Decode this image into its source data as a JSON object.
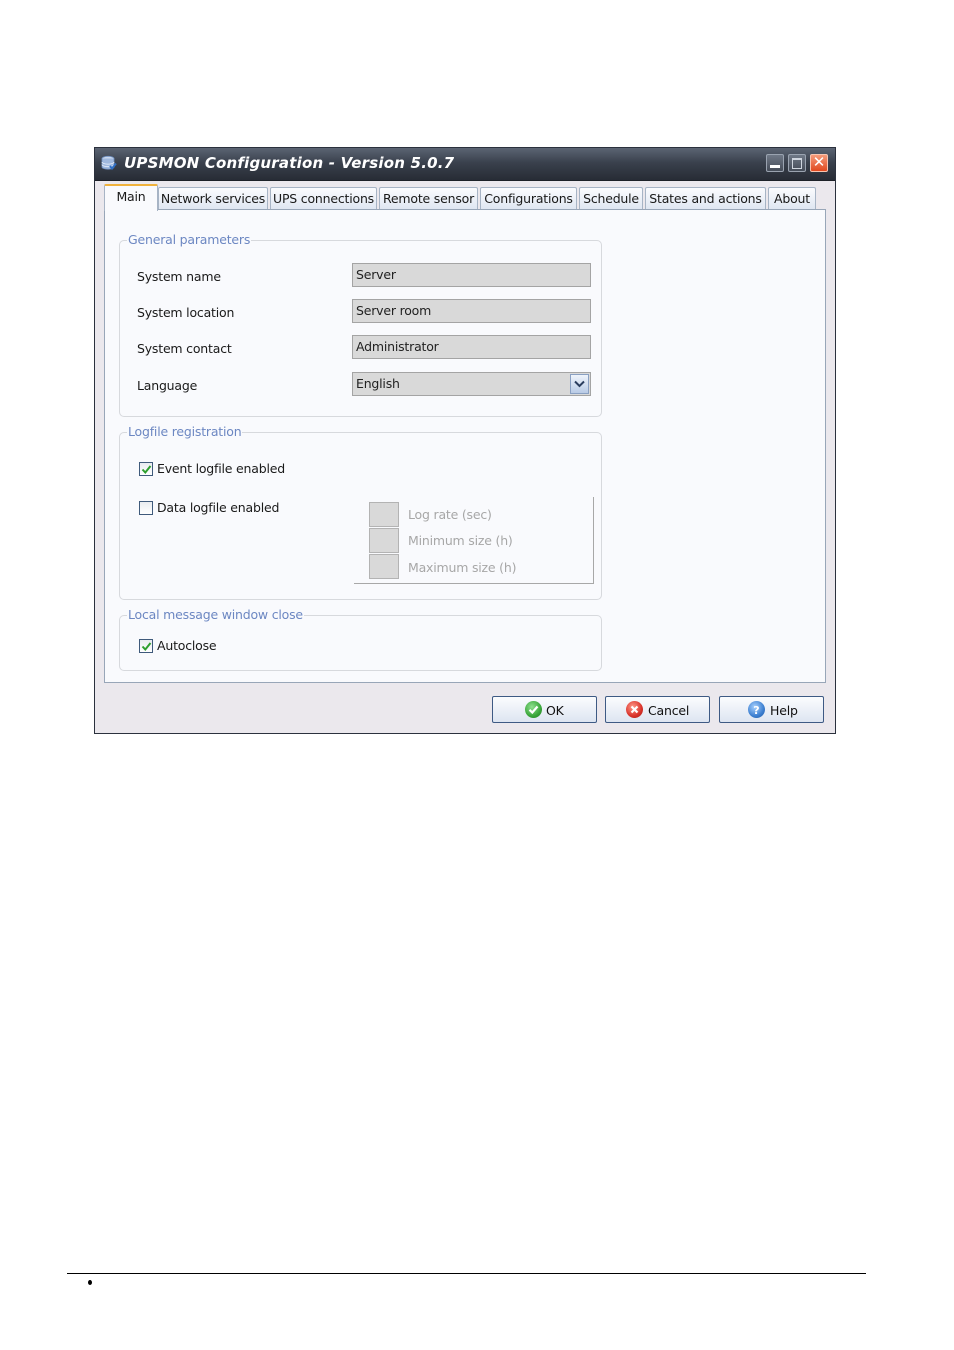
{
  "window": {
    "title": "UPSMON Configuration - Version 5.0.7",
    "controls": {
      "minimize": "minimize",
      "maximize": "maximize",
      "close": "✕"
    }
  },
  "tabs": [
    {
      "label": "Main",
      "active": true
    },
    {
      "label": "Network services"
    },
    {
      "label": "UPS connections"
    },
    {
      "label": "Remote sensor"
    },
    {
      "label": "Configurations"
    },
    {
      "label": "Schedule"
    },
    {
      "label": "States and actions"
    },
    {
      "label": "About"
    }
  ],
  "general": {
    "title": "General parameters",
    "system_name": {
      "label": "System name",
      "value": "Server"
    },
    "system_location": {
      "label": "System location",
      "value": "Server room"
    },
    "system_contact": {
      "label": "System contact",
      "value": "Administrator"
    },
    "language": {
      "label": "Language",
      "value": "English"
    }
  },
  "logfile": {
    "title": "Logfile registration",
    "event_logfile": {
      "label": "Event logfile enabled",
      "checked": true
    },
    "data_logfile": {
      "label": "Data logfile enabled",
      "checked": false
    },
    "log_rate": {
      "label": "Log rate (sec)",
      "value": ""
    },
    "min_size": {
      "label": "Minimum size (h)",
      "value": ""
    },
    "max_size": {
      "label": "Maximum size (h)",
      "value": ""
    }
  },
  "local_message": {
    "title": "Local message window close",
    "autoclose": {
      "label": "Autoclose",
      "checked": true
    }
  },
  "buttons": {
    "ok": "OK",
    "cancel": "Cancel",
    "help": "Help"
  },
  "colors": {
    "group_title": "#6c87c2",
    "active_tab_accent": "#f0b23c",
    "ok_icon": "#3aa63a",
    "cancel_icon": "#d9322a",
    "help_icon": "#3c7fd0"
  }
}
